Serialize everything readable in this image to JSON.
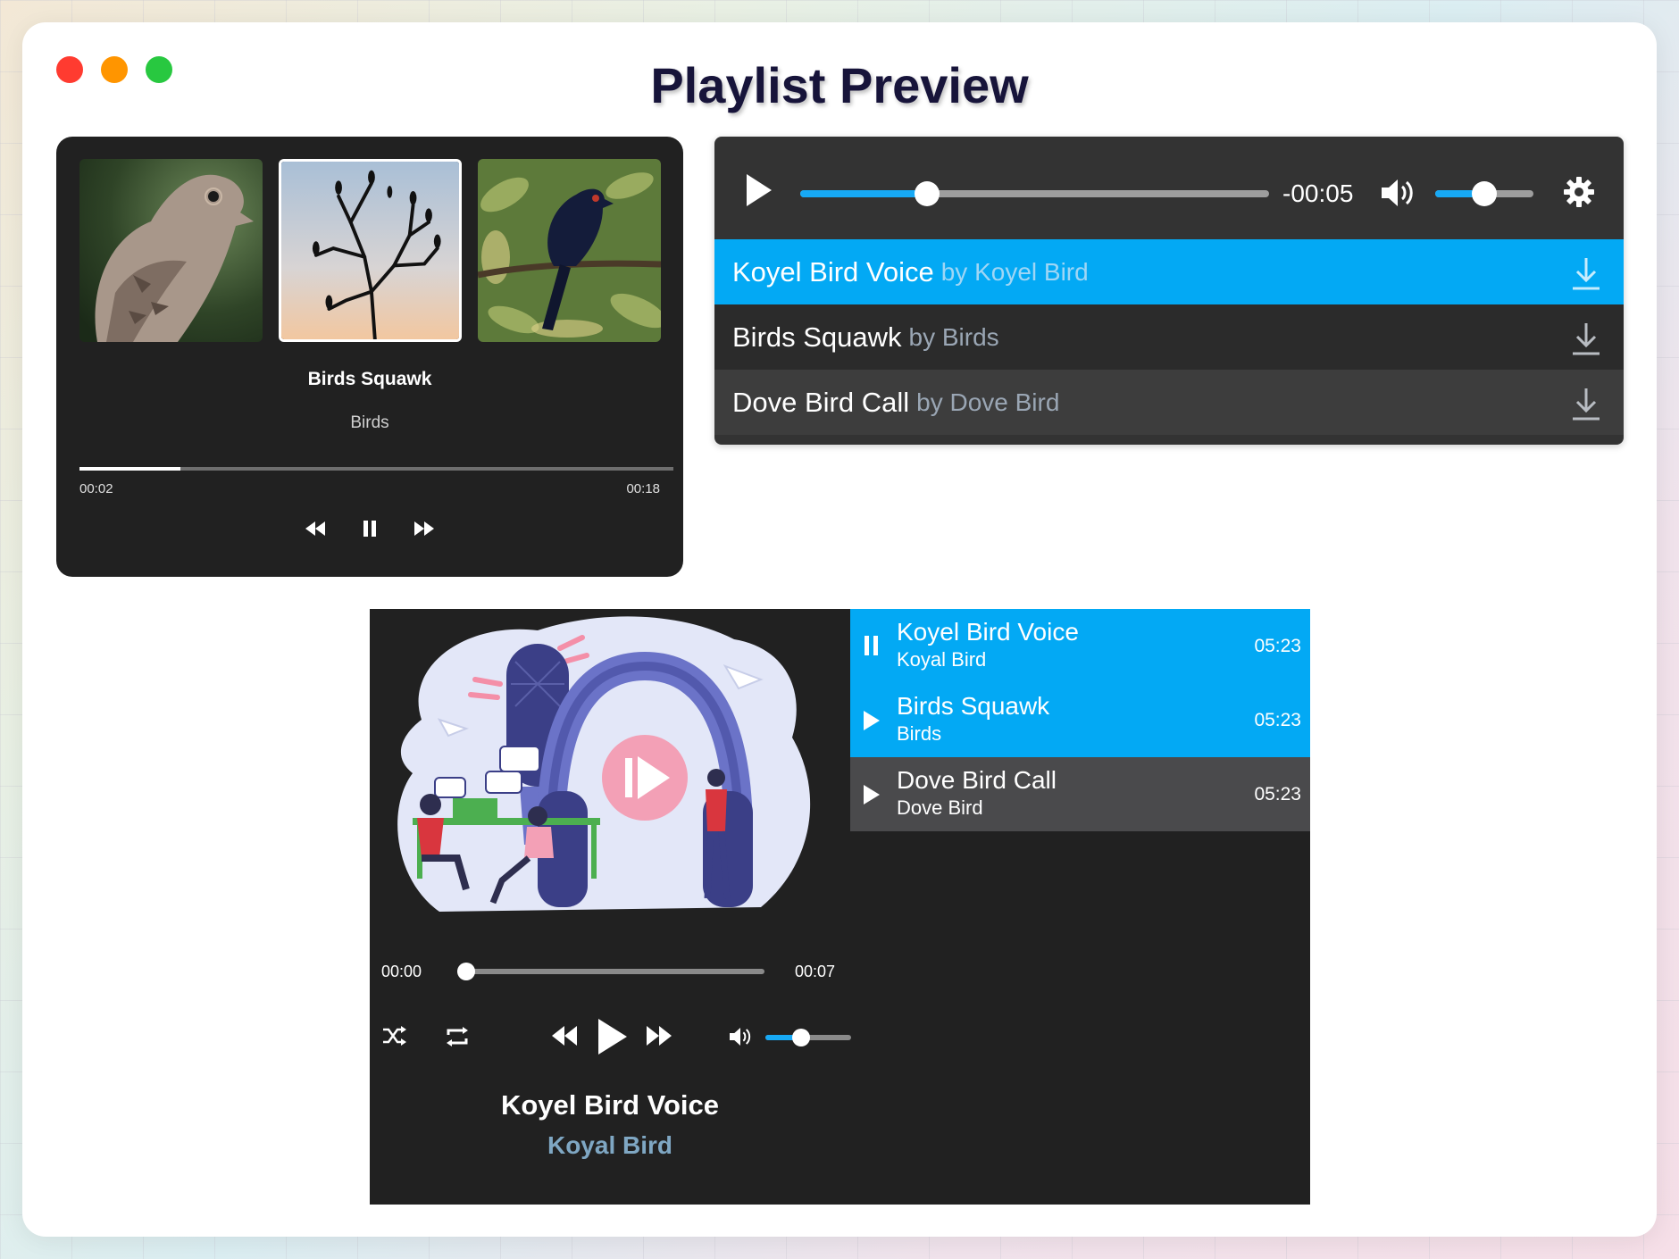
{
  "page": {
    "title": "Playlist Preview"
  },
  "player1": {
    "thumbnails": [
      {
        "name": "dove-thumbnail"
      },
      {
        "name": "birds-branch-thumbnail",
        "active": true
      },
      {
        "name": "koyel-thumbnail"
      }
    ],
    "title": "Birds Squawk",
    "artist": "Birds",
    "current_time": "00:02",
    "duration": "00:18",
    "progress": 0.17
  },
  "player2": {
    "remaining_time": "-00:05",
    "progress": 0.27,
    "volume": 0.5,
    "tracks": [
      {
        "title": "Koyel Bird Voice",
        "by": "by Koyel Bird",
        "active": true
      },
      {
        "title": "Birds Squawk",
        "by": "by Birds"
      },
      {
        "title": "Dove Bird Call",
        "by": "by Dove Bird"
      }
    ]
  },
  "player3": {
    "current_time": "00:00",
    "duration": "00:07",
    "progress": 0.0,
    "volume": 0.42,
    "now_title": "Koyel Bird Voice",
    "now_artist": "Koyal Bird",
    "playlist": [
      {
        "title": "Koyel Bird Voice",
        "artist": "Koyal Bird",
        "duration": "05:23",
        "state": "playing"
      },
      {
        "title": "Birds Squawk",
        "artist": "Birds",
        "duration": "05:23",
        "state": "paused"
      },
      {
        "title": "Dove Bird Call",
        "artist": "Dove Bird",
        "duration": "05:23",
        "state": "paused"
      }
    ]
  },
  "colors": {
    "accent": "#03a9f4",
    "dark": "#212121",
    "title": "#17143a"
  }
}
